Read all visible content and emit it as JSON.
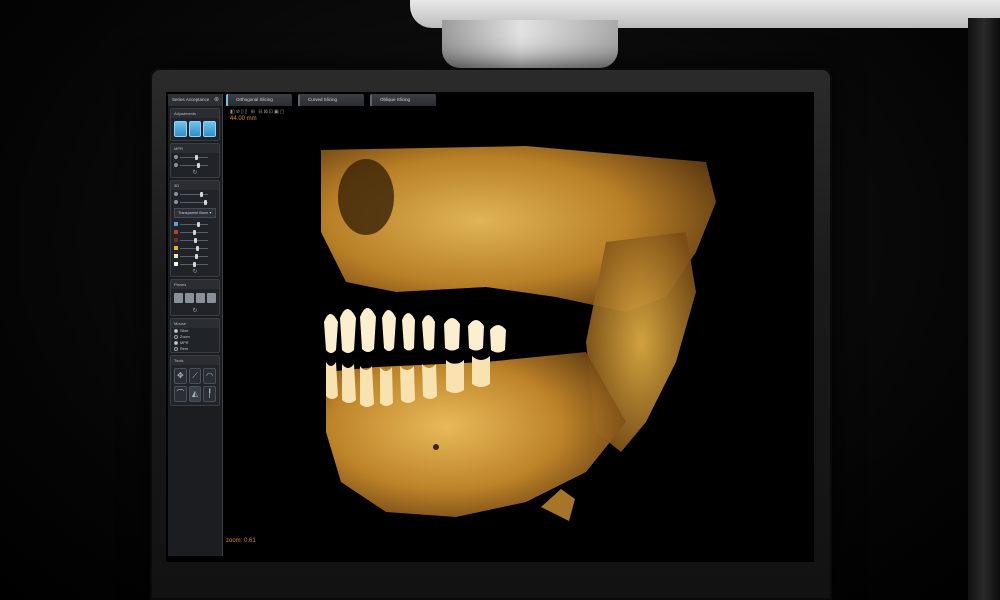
{
  "panel": {
    "header": "Series Acceptance",
    "sections": {
      "adjustments": "Adjustments",
      "mpr": "MPR",
      "three_d": "3D",
      "preset": "Transparent Bone",
      "planes": "Planes",
      "mouse": "Mouse",
      "tools": "Tools"
    },
    "mouse_options": [
      "Slide",
      "Zoom"
    ],
    "mode_options": [
      "MPR",
      "Rem"
    ]
  },
  "tabs": [
    "Orthogonal Slicing",
    "Curved Slicing",
    "Oblique Slicing"
  ],
  "viewport": {
    "measurement": "44.00 mm",
    "zoom_label": "zoom: 0.61"
  },
  "colors": {
    "accent": "#6fc2ee",
    "overlay_text": "#d4902f",
    "bone": "#d9a445"
  }
}
